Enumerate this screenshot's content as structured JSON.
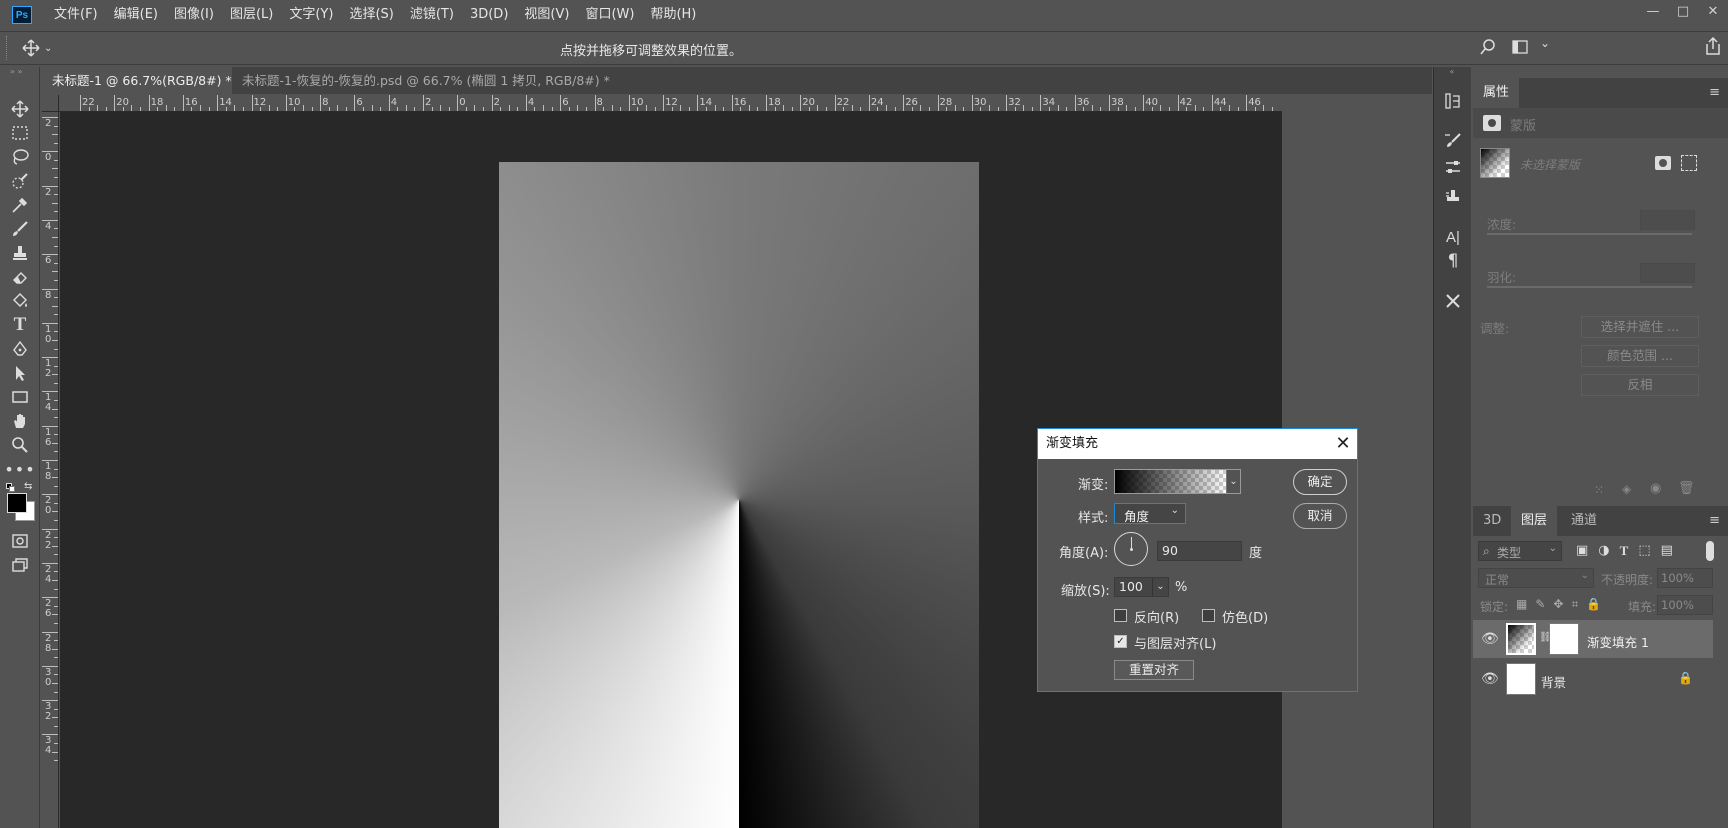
{
  "app": {
    "logo": "Ps"
  },
  "menu": [
    "文件(F)",
    "编辑(E)",
    "图像(I)",
    "图层(L)",
    "文字(Y)",
    "选择(S)",
    "滤镜(T)",
    "3D(D)",
    "视图(V)",
    "窗口(W)",
    "帮助(H)"
  ],
  "window_controls": {
    "minimize": "—",
    "restore": "□",
    "close": "✕"
  },
  "options_bar": {
    "hint": "点按并拖移可调整效果的位置。"
  },
  "tabs": [
    {
      "label": "未标题-1 @ 66.7%(RGB/8#) *",
      "close": "×"
    },
    {
      "label": "未标题-1-恢复的-恢复的.psd @ 66.7% (椭圆 1 拷贝, RGB/8#) *",
      "close": "×"
    }
  ],
  "hruler_labels": [
    "22",
    "20",
    "18",
    "16",
    "14",
    "12",
    "10",
    "8",
    "6",
    "4",
    "2",
    "0",
    "2",
    "4",
    "6",
    "8",
    "10",
    "12",
    "14",
    "16",
    "18",
    "20",
    "22",
    "24",
    "26",
    "28",
    "30",
    "32",
    "34",
    "36",
    "38",
    "40",
    "42",
    "44",
    "46"
  ],
  "vruler_labels": [
    "2",
    "0",
    "2",
    "4",
    "6",
    "8",
    "1\n0",
    "1\n2",
    "1\n4",
    "1\n6",
    "1\n8",
    "2\n0",
    "2\n2",
    "2\n4",
    "2\n6",
    "2\n8",
    "3\n0",
    "3\n2",
    "3\n4"
  ],
  "properties": {
    "tab": "属性",
    "mask_label": "蒙版",
    "no_mask": "未选择蒙版",
    "density_label": "浓度:",
    "feather_label": "羽化:",
    "adjust_label": "调整:",
    "btn_select": "选择并遮住 ...",
    "btn_color": "颜色范围 ...",
    "btn_invert": "反相"
  },
  "layers_panel": {
    "tabs": [
      "3D",
      "图层",
      "通道"
    ],
    "filter_kind": "类型",
    "blend_mode": "正常",
    "opacity_label": "不透明度:",
    "opacity_value": "100%",
    "lock_label": "锁定:",
    "fill_label": "填充:",
    "fill_value": "100%",
    "layers": [
      {
        "name": "渐变填充 1",
        "selected": true
      },
      {
        "name": "背景",
        "selected": false
      }
    ]
  },
  "dialog": {
    "title": "渐变填充",
    "close": "✕",
    "gradient_label": "渐变:",
    "style_label": "样式:",
    "style_value": "角度",
    "angle_label": "角度(A):",
    "angle_value": "90",
    "angle_unit": "度",
    "scale_label": "缩放(S):",
    "scale_value": "100",
    "scale_unit": "%",
    "reverse_label": "反向(R)",
    "dither_label": "仿色(D)",
    "align_label": "与图层对齐(L)",
    "reverse_checked": false,
    "dither_checked": false,
    "align_checked": true,
    "reset_button": "重置对齐",
    "ok_button": "确定",
    "cancel_button": "取消"
  },
  "colors": {
    "accent": "#1a8ad8",
    "panel": "#535353",
    "dark": "#424242",
    "canvas": "#282828"
  }
}
